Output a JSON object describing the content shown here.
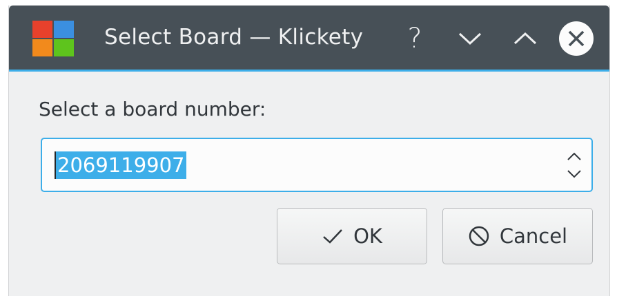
{
  "window": {
    "title": "Select Board — Klickety",
    "icon": "klickety-app-icon",
    "controls": {
      "help_label": "?",
      "minimize_icon": "chevron-down-icon",
      "maximize_icon": "chevron-up-icon",
      "close_icon": "close-icon"
    }
  },
  "dialog": {
    "prompt": "Select a board number:",
    "board_number": "2069119907",
    "board_number_selected": true
  },
  "buttons": {
    "ok_label": "OK",
    "ok_icon": "checkmark-icon",
    "cancel_label": "Cancel",
    "cancel_icon": "cancel-icon"
  },
  "colors": {
    "titlebar": "#475057",
    "accent": "#3daee9",
    "window_bg": "#eff0f1",
    "text": "#31363b"
  }
}
